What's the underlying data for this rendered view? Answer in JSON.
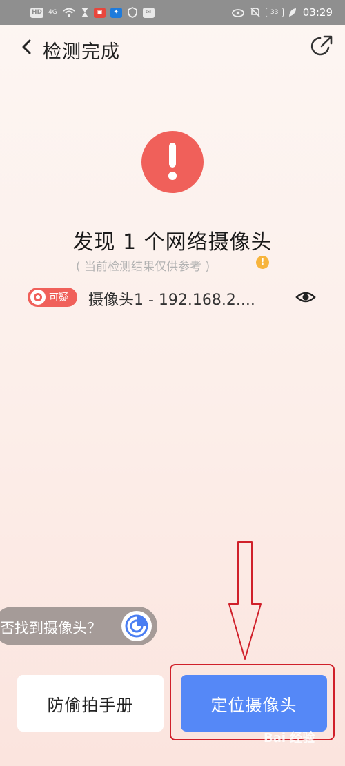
{
  "status_bar": {
    "left_badges": [
      "HD",
      "4G"
    ],
    "battery": "33",
    "time": "03:29"
  },
  "header": {
    "title": "检测完成",
    "back_icon": "chevron-left-icon",
    "share_icon": "share-icon"
  },
  "result": {
    "icon": "exclamation-icon",
    "title": "发现 1 个网络摄像头",
    "note": "( 当前检测结果仅供参考 )",
    "info_symbol": "!"
  },
  "camera_list": [
    {
      "badge": "可疑",
      "label": "摄像头1 - 192.168.2....",
      "action_icon": "eye-icon"
    }
  ],
  "not_found": {
    "text": "否找到摄像头？",
    "icon": "radar-icon"
  },
  "buttons": {
    "manual": "防偷拍手册",
    "locate": "定位摄像头"
  },
  "watermark": "Bai 经验",
  "colors": {
    "warning_red": "#f0605a",
    "primary_blue": "#5588f7",
    "annotation_red": "#d0202a",
    "info_orange": "#f7b43c"
  }
}
